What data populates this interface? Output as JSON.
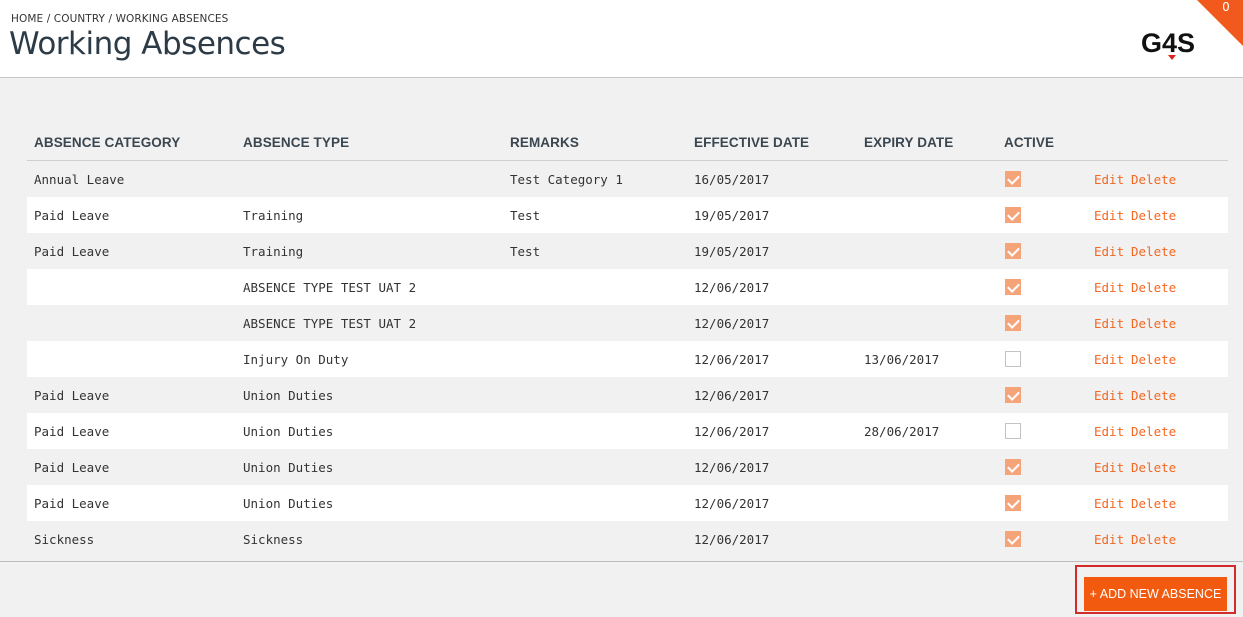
{
  "header": {
    "breadcrumb": "HOME / COUNTRY / WORKING ABSENCES",
    "title": "Working Absences",
    "logo_text": "G4S",
    "notification_count": "0"
  },
  "table": {
    "columns": [
      "ABSENCE CATEGORY",
      "ABSENCE TYPE",
      "REMARKS",
      "EFFECTIVE DATE",
      "EXPIRY DATE",
      "ACTIVE"
    ],
    "rows": [
      {
        "category": "Annual Leave",
        "type": "",
        "remarks": "Test Category 1",
        "effective": "16/05/2017",
        "expiry": "",
        "active": true
      },
      {
        "category": "Paid Leave",
        "type": "Training",
        "remarks": "Test",
        "effective": "19/05/2017",
        "expiry": "",
        "active": true
      },
      {
        "category": "Paid Leave",
        "type": "Training",
        "remarks": "Test",
        "effective": "19/05/2017",
        "expiry": "",
        "active": true
      },
      {
        "category": "",
        "type": "ABSENCE TYPE TEST UAT 2",
        "remarks": "",
        "effective": "12/06/2017",
        "expiry": "",
        "active": true
      },
      {
        "category": "",
        "type": "ABSENCE TYPE TEST UAT 2",
        "remarks": "",
        "effective": "12/06/2017",
        "expiry": "",
        "active": true
      },
      {
        "category": "",
        "type": "Injury On Duty",
        "remarks": "",
        "effective": "12/06/2017",
        "expiry": "13/06/2017",
        "active": false
      },
      {
        "category": "Paid Leave",
        "type": "Union Duties",
        "remarks": "",
        "effective": "12/06/2017",
        "expiry": "",
        "active": true
      },
      {
        "category": "Paid Leave",
        "type": "Union Duties",
        "remarks": "",
        "effective": "12/06/2017",
        "expiry": "28/06/2017",
        "active": false
      },
      {
        "category": "Paid Leave",
        "type": "Union Duties",
        "remarks": "",
        "effective": "12/06/2017",
        "expiry": "",
        "active": true
      },
      {
        "category": "Paid Leave",
        "type": "Union Duties",
        "remarks": "",
        "effective": "12/06/2017",
        "expiry": "",
        "active": true
      },
      {
        "category": "Sickness",
        "type": "Sickness",
        "remarks": "",
        "effective": "12/06/2017",
        "expiry": "",
        "active": true
      }
    ],
    "edit_label": "Edit",
    "delete_label": "Delete"
  },
  "footer": {
    "add_button_label": "+ ADD NEW ABSENCE"
  },
  "colors": {
    "accent": "#f25a0f",
    "link": "#f26722",
    "checkbox_on": "#f5a47a",
    "highlight": "#d42a2a"
  }
}
